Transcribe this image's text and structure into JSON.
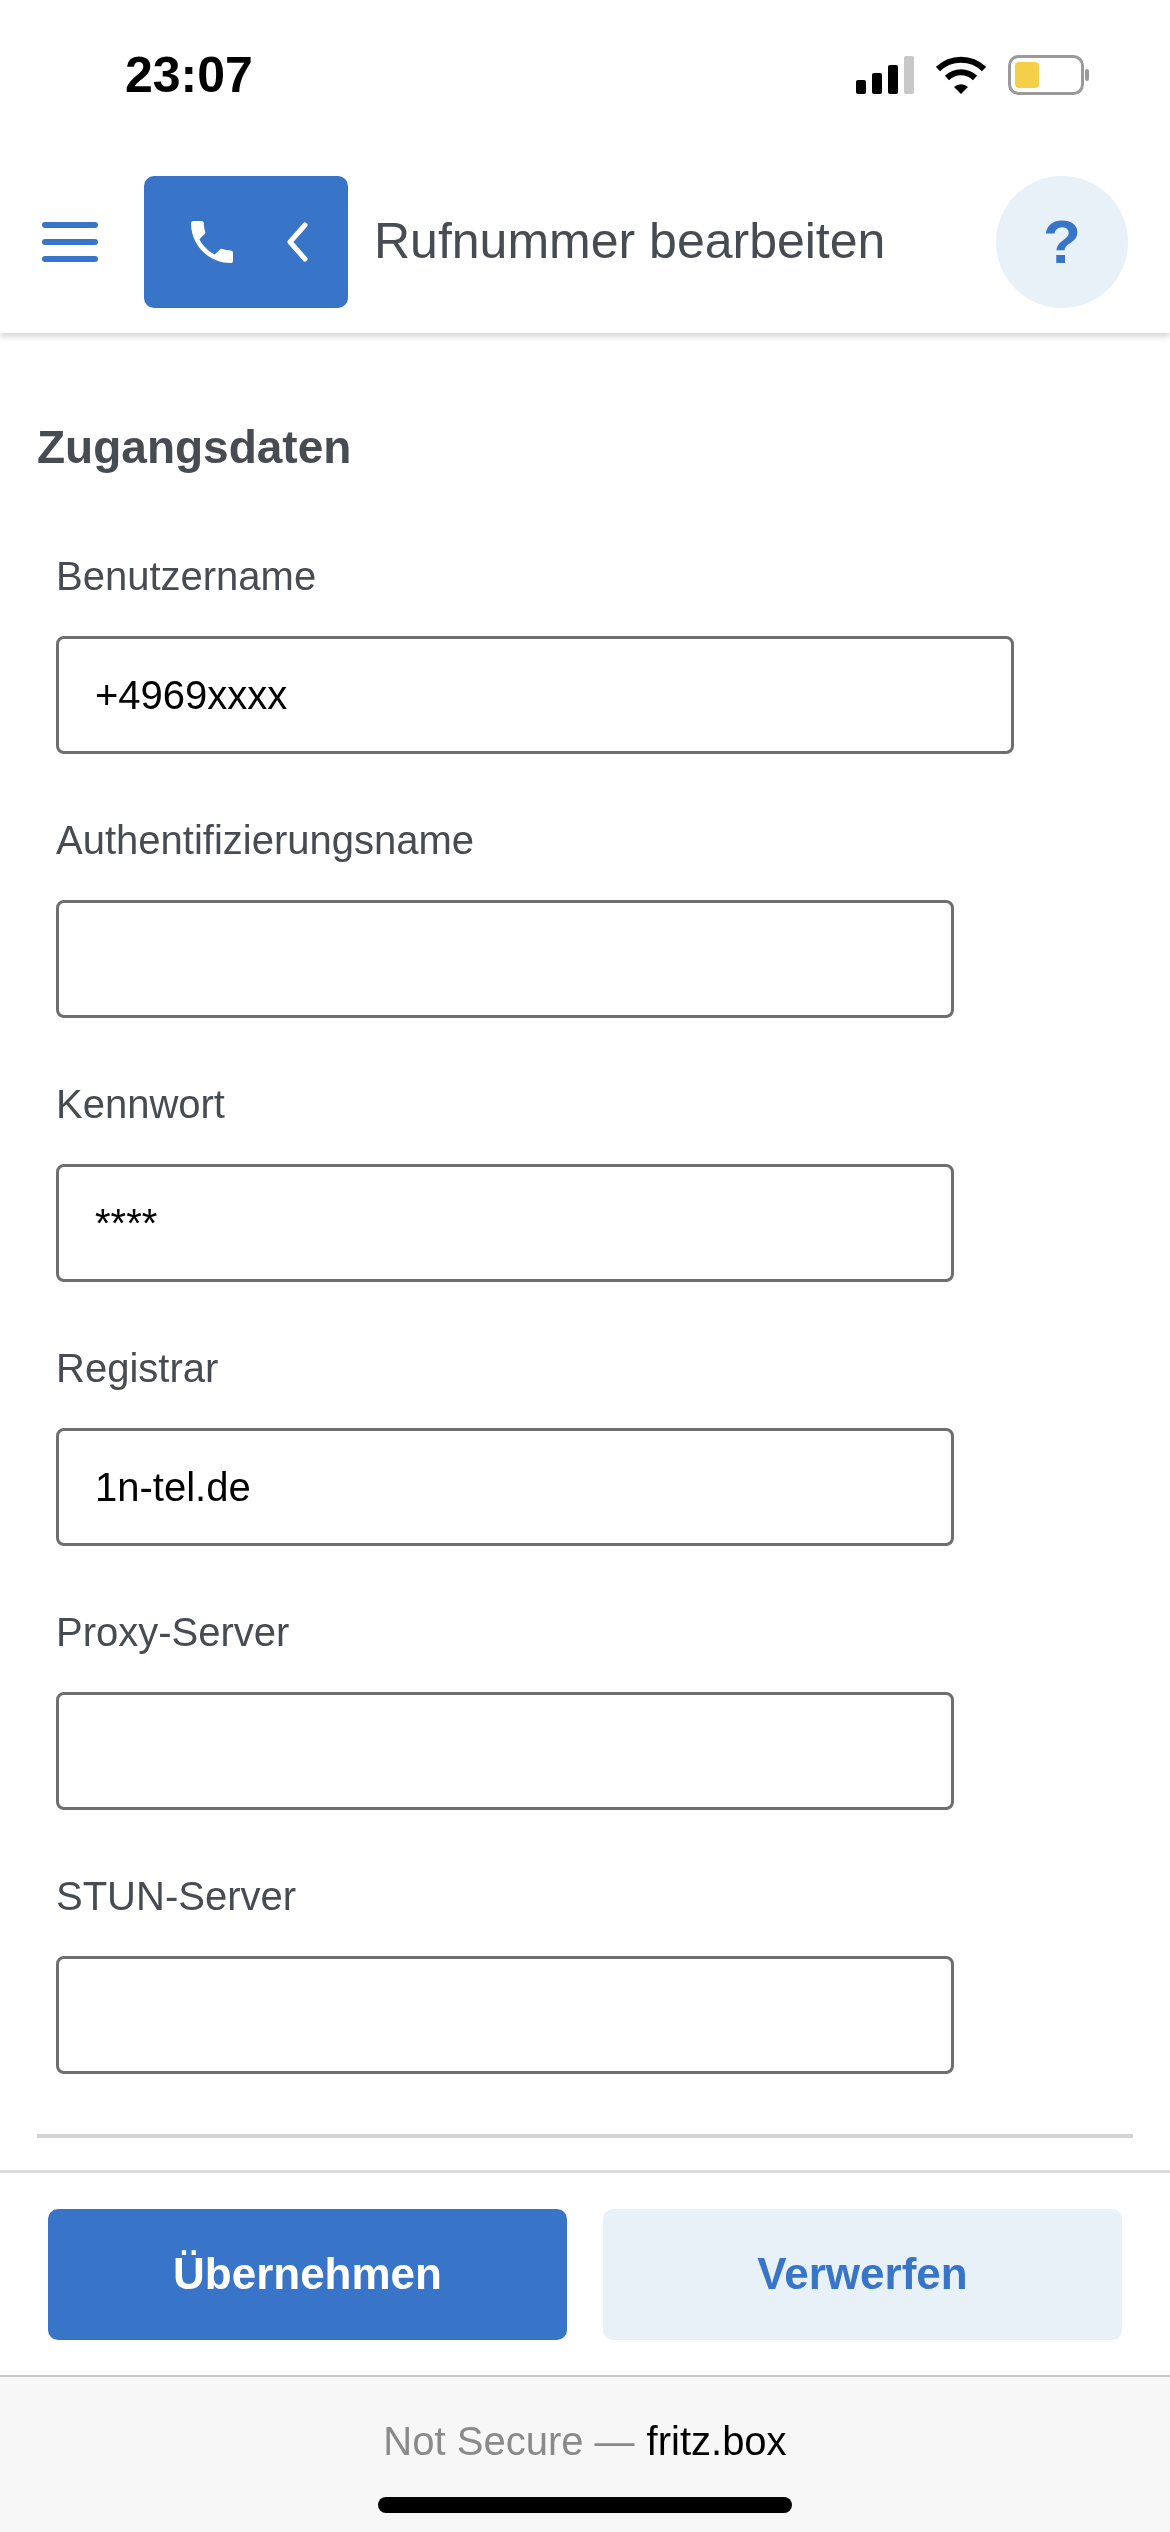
{
  "status_bar": {
    "time": "23:07"
  },
  "header": {
    "title": "Rufnummer bearbeiten",
    "help": "?"
  },
  "section": {
    "title": "Zugangsdaten"
  },
  "fields": [
    {
      "label": "Benutzername",
      "value": "+4969xxxx",
      "wide": true
    },
    {
      "label": "Authentifizierungsname",
      "wide": false
    },
    {
      "label": "Kennwort",
      "value": "****",
      "wide": false
    },
    {
      "label": "Registrar",
      "value": "1n-tel.de",
      "wide": false
    },
    {
      "label": "Proxy-Server",
      "wide": false
    },
    {
      "label": "STUN-Server",
      "wide": false
    }
  ],
  "buttons": [
    {
      "label": "Übernehmen",
      "kind": "primary"
    },
    {
      "label": "Verwerfen",
      "kind": "secondary"
    }
  ],
  "browser_bar": {
    "security": "Not Secure —",
    "domain": "fritz.box"
  }
}
